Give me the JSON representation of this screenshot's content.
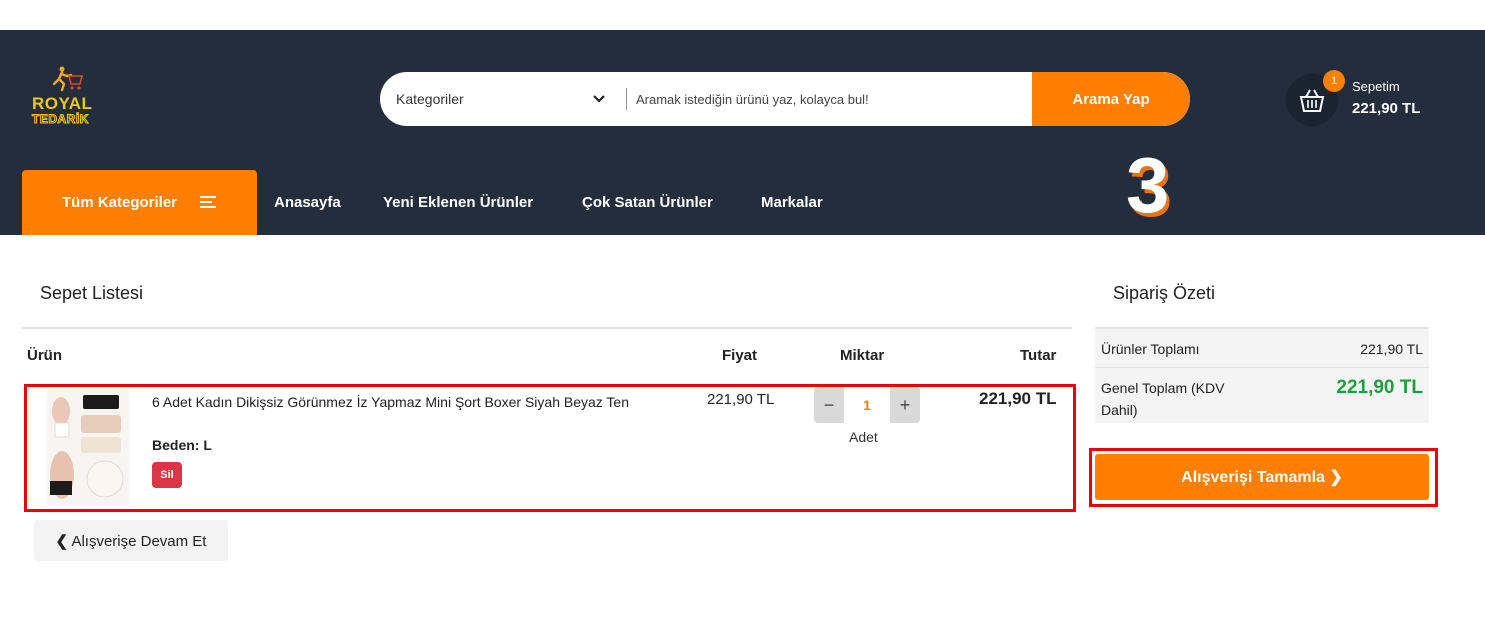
{
  "header": {
    "logo": {
      "line1": "ROYAL",
      "line2": "TEDARİK"
    },
    "search": {
      "category_label": "Kategoriler",
      "placeholder": "Aramak istediğin ürünü yaz, kolayca bul!",
      "button_label": "Arama Yap"
    },
    "cart": {
      "badge": "1",
      "title": "Sepetim",
      "total": "221,90 TL"
    }
  },
  "nav": {
    "all_categories": "Tüm Kategoriler",
    "links": [
      "Anasayfa",
      "Yeni Eklenen Ürünler",
      "Çok Satan Ürünler",
      "Markalar"
    ]
  },
  "annotation": "3",
  "cart_list": {
    "title": "Sepet Listesi",
    "columns": {
      "product": "Ürün",
      "price": "Fiyat",
      "quantity": "Miktar",
      "total": "Tutar"
    },
    "items": [
      {
        "name": "6 Adet Kadın Dikişsiz Görünmez İz Yapmaz Mini Şort Boxer Siyah Beyaz Ten",
        "size": "Beden: L",
        "delete_label": "Sil",
        "price": "221,90 TL",
        "quantity": "1",
        "unit": "Adet",
        "total": "221,90 TL"
      }
    ],
    "continue_label": "Alışverişe Devam Et"
  },
  "summary": {
    "title": "Sipariş Özeti",
    "products_total_label": "Ürünler Toplamı",
    "products_total": "221,90 TL",
    "grand_total_label": "Genel Toplam (KDV Dahil)",
    "grand_total": "221,90 TL",
    "checkout_label": "Alışverişi Tamamla"
  },
  "colors": {
    "header_bg": "#232d3b",
    "accent": "#ff7f00",
    "success": "#1e9e3e",
    "danger": "#dc3545",
    "highlight": "#ee0000"
  }
}
